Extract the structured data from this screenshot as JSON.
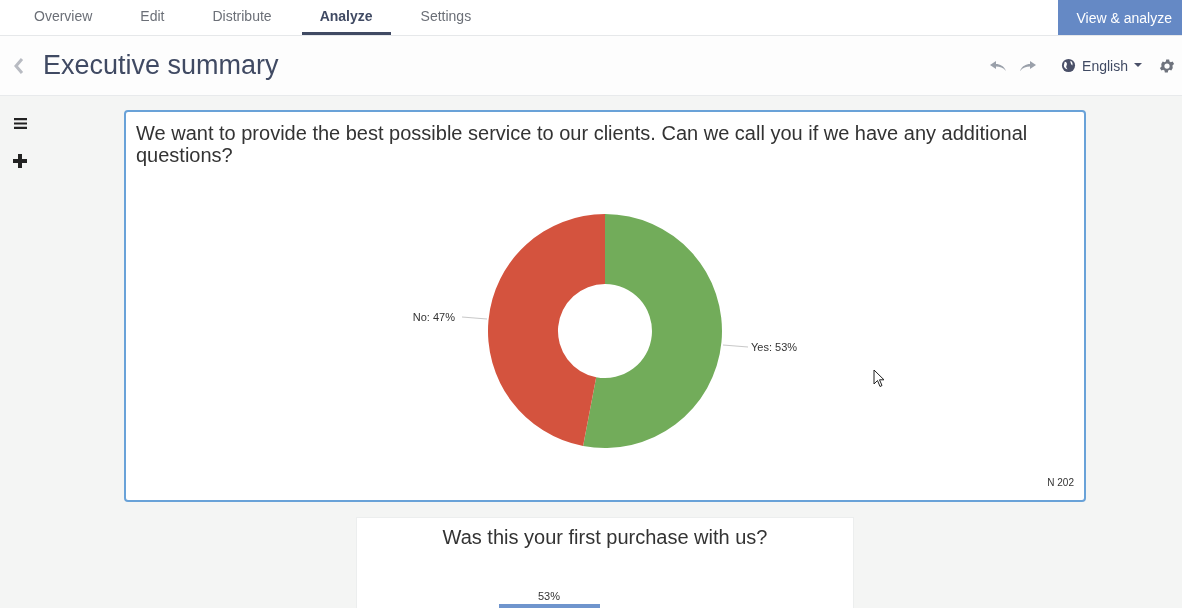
{
  "tabs": [
    {
      "label": "Overview",
      "selected": false
    },
    {
      "label": "Edit",
      "selected": false
    },
    {
      "label": "Distribute",
      "selected": false
    },
    {
      "label": "Analyze",
      "selected": true
    },
    {
      "label": "Settings",
      "selected": false
    }
  ],
  "primary_button": "View & analyze",
  "header": {
    "title": "Executive summary",
    "language": "English"
  },
  "cards": [
    {
      "question": "We want to provide the best possible service to our clients. Can we call you if we have any additional questions?",
      "selected": true,
      "n": "N 202",
      "chart_data": {
        "type": "donut",
        "categories": [
          "Yes: 53%",
          "No: 47%"
        ],
        "values": [
          53,
          47
        ]
      }
    },
    {
      "question": "Was this your first purchase with us?",
      "selected": false,
      "bar_label": "53%"
    }
  ]
}
